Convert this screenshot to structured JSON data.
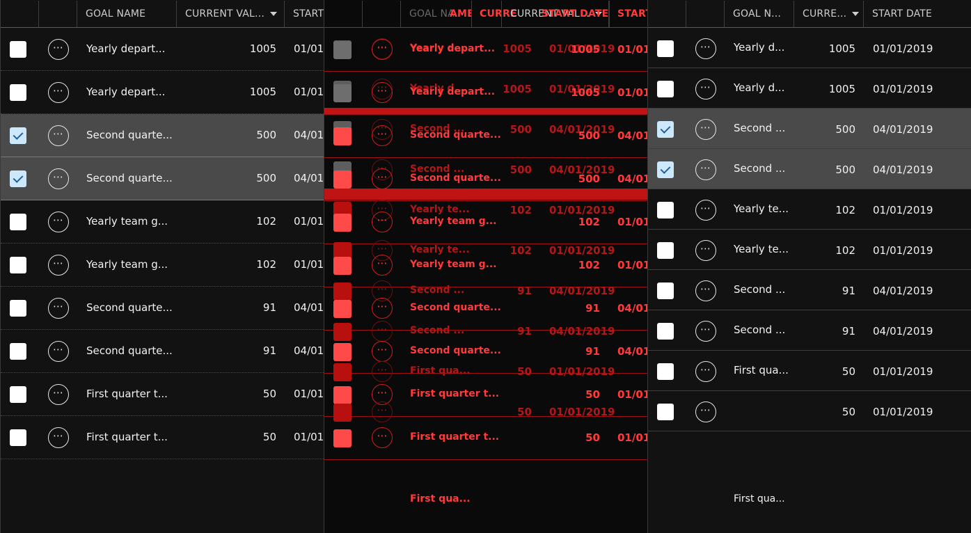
{
  "panels": {
    "left": {
      "headers": {
        "name": "GOAL NAME",
        "value": "CURRENT VAL...",
        "date": "START"
      },
      "rows": [
        {
          "name": "Yearly depart...",
          "value": "1005",
          "date": "01/01/",
          "checked": false
        },
        {
          "name": "Yearly depart...",
          "value": "1005",
          "date": "01/01/",
          "checked": false
        },
        {
          "name": "Second quarte...",
          "value": "500",
          "date": "04/01,",
          "checked": true
        },
        {
          "name": "Second quarte...",
          "value": "500",
          "date": "04/01/",
          "checked": true
        },
        {
          "name": "Yearly team g...",
          "value": "102",
          "date": "01/01/",
          "checked": false
        },
        {
          "name": "Yearly team g...",
          "value": "102",
          "date": "01/01/",
          "checked": false
        },
        {
          "name": "Second quarte...",
          "value": "91",
          "date": "04/01,",
          "checked": false
        },
        {
          "name": "Second quarte...",
          "value": "91",
          "date": "04/01/",
          "checked": false
        },
        {
          "name": "First quarter t...",
          "value": "50",
          "date": "01/01/",
          "checked": false
        },
        {
          "name": "First quarter t...",
          "value": "50",
          "date": "01/01/",
          "checked": false
        }
      ]
    },
    "middle": {
      "headers": {
        "goal_name": "GOAL NA",
        "ame": "AME",
        "curr": "CURRE",
        "current_val": "CURRENT VAL...",
        "start_date": "START DATE",
        "start": "START"
      },
      "rows": [
        {
          "name": "Yearly depart...",
          "value": "1005",
          "date": "01/01/",
          "ghost_name": "Yearly d...",
          "ghost_value": "1005",
          "ghost_date": "01/01/2019"
        },
        {
          "name": "Yearly depart...",
          "value": "1005",
          "date": "01/01/",
          "ghost_name": "Yearly d...",
          "ghost_value": "1005",
          "ghost_date": "01/01/2019"
        },
        {
          "name": "Second quarte...",
          "value": "500",
          "date": "04/01/",
          "ghost_name": "Second ...",
          "ghost_value": "500",
          "ghost_date": "04/01/2019"
        },
        {
          "name": "Second quarte...",
          "value": "500",
          "date": "04/01/",
          "ghost_name": "Second ...",
          "ghost_value": "500",
          "ghost_date": "04/01/2019"
        },
        {
          "name": "Yearly team g...",
          "value": "102",
          "date": "01/01/",
          "ghost_name": "Yearly te...",
          "ghost_value": "102",
          "ghost_date": "01/01/2019"
        },
        {
          "name": "Yearly team g...",
          "value": "102",
          "date": "01/01/",
          "ghost_name": "Yearly te...",
          "ghost_value": "102",
          "ghost_date": "01/01/2019"
        },
        {
          "name": "Second quarte...",
          "value": "91",
          "date": "04/01/",
          "ghost_name": "Second ...",
          "ghost_value": "91",
          "ghost_date": "04/01/2019"
        },
        {
          "name": "Second quarte...",
          "value": "91",
          "date": "04/01/",
          "ghost_name": "Second ...",
          "ghost_value": "91",
          "ghost_date": "04/01/2019"
        },
        {
          "name": "First quarter t...",
          "value": "50",
          "date": "01/01/",
          "ghost_name": "First qua...",
          "ghost_value": "50",
          "ghost_date": "01/01/2019"
        },
        {
          "name": "First quarter t...",
          "value": "50",
          "date": "01/01/",
          "ghost_name": "",
          "ghost_value": "50",
          "ghost_date": "01/01/2019"
        }
      ],
      "trailing_text": "First qua..."
    },
    "right": {
      "headers": {
        "name": "GOAL N...",
        "value": "CURRE...",
        "date": "START DATE"
      },
      "rows": [
        {
          "name": "Yearly d...",
          "value": "1005",
          "date": "01/01/2019",
          "checked": false
        },
        {
          "name": "Yearly d...",
          "value": "1005",
          "date": "01/01/2019",
          "checked": false
        },
        {
          "name": "Second ...",
          "value": "500",
          "date": "04/01/2019",
          "checked": true
        },
        {
          "name": "Second ...",
          "value": "500",
          "date": "04/01/2019",
          "checked": true
        },
        {
          "name": "Yearly te...",
          "value": "102",
          "date": "01/01/2019",
          "checked": false
        },
        {
          "name": "Yearly te...",
          "value": "102",
          "date": "01/01/2019",
          "checked": false
        },
        {
          "name": "Second ...",
          "value": "91",
          "date": "04/01/2019",
          "checked": false
        },
        {
          "name": "Second ...",
          "value": "91",
          "date": "04/01/2019",
          "checked": false
        },
        {
          "name": "First qua...",
          "value": "50",
          "date": "01/01/2019",
          "checked": false
        },
        {
          "name": "",
          "value": "50",
          "date": "01/01/2019",
          "checked": false
        }
      ],
      "trailing_text": "First qua..."
    }
  },
  "icons": {
    "more": "more-horizontal-icon",
    "caret": "sort-down-icon",
    "check": "checkmark-icon"
  },
  "colors": {
    "selected_row": "#4a4a4a",
    "checkbox_checked": "#cde8fb",
    "overlay_red": "#ff3b3b",
    "overlay_dark_red": "#b41717"
  }
}
